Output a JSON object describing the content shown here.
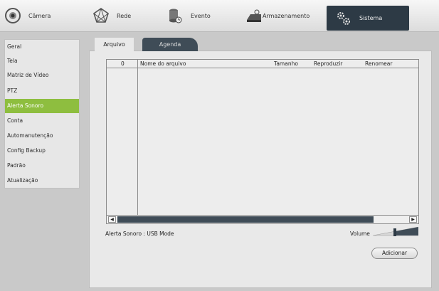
{
  "nav": {
    "camera": "Câmera",
    "rede": "Rede",
    "evento": "Evento",
    "armazenamento": "Armazenamento",
    "sistema": "Sistema"
  },
  "sidebar": {
    "items": [
      {
        "label": "Geral"
      },
      {
        "label": "Tela"
      },
      {
        "label": "Matriz de Vídeo"
      },
      {
        "label": "PTZ"
      },
      {
        "label": "Alerta Sonoro"
      },
      {
        "label": "Conta"
      },
      {
        "label": "Automanutenção"
      },
      {
        "label": "Config Backup"
      },
      {
        "label": "Padrão"
      },
      {
        "label": "Atualização"
      }
    ],
    "active_index": 4
  },
  "tabs": {
    "arquivo": "Arquivo",
    "agenda": "Agenda"
  },
  "file_list": {
    "columns": [
      "0",
      "Nome do arquivo",
      "Tamanho",
      "Reproduzir",
      "Renomear"
    ],
    "rows": []
  },
  "footer": {
    "usb_mode": "Alerta Sonoro : USB Mode",
    "volume_label": "Volume",
    "add_button": "Adicionar"
  },
  "colors": {
    "active_sidebar": "#8ebe3f",
    "active_nav": "#2d3a45",
    "scroll_thumb": "#3f4c57"
  }
}
